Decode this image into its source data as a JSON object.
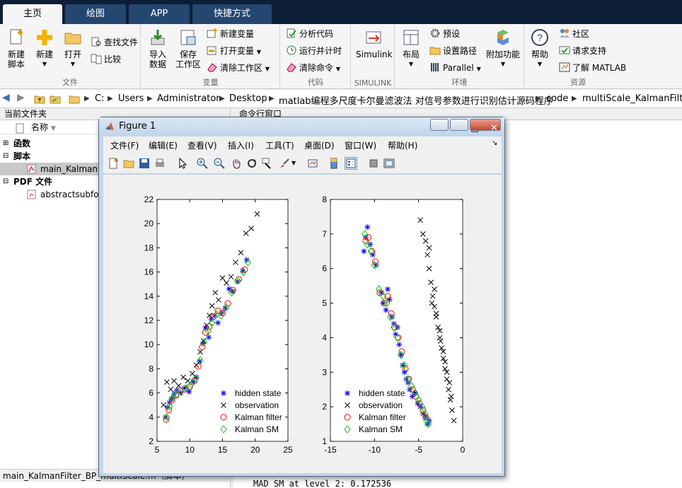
{
  "tabs": [
    {
      "label": "主页",
      "active": true
    },
    {
      "label": "绘图",
      "active": false
    },
    {
      "label": "APP",
      "active": false
    },
    {
      "label": "快捷方式",
      "active": false
    }
  ],
  "ribbon": {
    "file": {
      "label": "文件",
      "new_script": "新建\n脚本",
      "new": "新建",
      "open": "打开",
      "find_files": "查找文件",
      "compare": "比较"
    },
    "variable": {
      "label": "变量",
      "import": "导入\n数据",
      "save_ws": "保存\n工作区",
      "new_var": "新建变量",
      "open_var": "打开变量",
      "clear_ws": "清除工作区"
    },
    "code": {
      "label": "代码",
      "analyze": "分析代码",
      "run_time": "运行并计时",
      "clear_cmd": "清除命令"
    },
    "simulink": {
      "label": "SIMULINK",
      "simulink": "Simulink"
    },
    "env": {
      "label": "环境",
      "layout": "布局",
      "prefs": "预设",
      "set_path": "设置路径",
      "parallel": "Parallel",
      "addons": "附加功能"
    },
    "resources": {
      "label": "资源",
      "help": "帮助",
      "community": "社区",
      "support": "请求支持",
      "learn": "了解 MATLAB"
    }
  },
  "address": {
    "parts": [
      "C:",
      "Users",
      "Administrator",
      "Desktop",
      "matlab编程多尺度卡尔曼滤波法 对信号参数进行识别估计源码程序",
      "code",
      "multiScale_KalmanFilter"
    ]
  },
  "filepanel": {
    "title": "当前文件夹",
    "col_name": "名称",
    "rows": [
      {
        "label": "函数",
        "type": "group"
      },
      {
        "label": "脚本",
        "type": "group"
      },
      {
        "label": "main_KalmanFi",
        "type": "file"
      },
      {
        "label": "PDF 文件",
        "type": "group"
      },
      {
        "label": "abstractsubfo",
        "type": "file"
      }
    ],
    "status": "main_KalmanFilter_BP_multiScale.m（脚本）"
  },
  "cmdpanel": {
    "title": "命令行窗口",
    "line": "MAD SM at level 2: 0.172536"
  },
  "figure": {
    "title": "Figure 1",
    "menu": [
      "文件(F)",
      "编辑(E)",
      "查看(V)",
      "插入(I)",
      "工具(T)",
      "桌面(D)",
      "窗口(W)",
      "帮助(H)"
    ]
  },
  "chart_data": [
    {
      "type": "scatter",
      "xlim": [
        5,
        25
      ],
      "ylim": [
        2,
        22
      ],
      "xticks": [
        "5",
        "10",
        "15",
        "20",
        "25"
      ],
      "yticks": [
        "2",
        "4",
        "6",
        "8",
        "10",
        "12",
        "14",
        "16",
        "18",
        "20",
        "22"
      ],
      "legend": [
        "hidden state",
        "observation",
        "Kalman filter",
        "Kalman SM"
      ],
      "legend_position": "bottom-right",
      "series": [
        {
          "name": "hidden state",
          "marker": "*",
          "color": "#0000ff",
          "x": [
            6.3,
            6.6,
            6.9,
            7.2,
            7.6,
            8.0,
            8.6,
            9.2,
            9.9,
            10.5,
            11.0,
            11.5,
            12.0,
            12.4,
            12.9,
            13.3,
            13.8,
            14.3,
            14.9,
            15.4,
            16.0,
            16.6,
            17.3,
            18.1,
            18.7
          ],
          "y": [
            4.0,
            4.8,
            5.2,
            5.5,
            5.9,
            6.2,
            6.0,
            6.4,
            6.1,
            6.9,
            7.3,
            8.6,
            10.1,
            11.4,
            10.6,
            12.1,
            12.4,
            11.8,
            12.6,
            13.0,
            14.6,
            14.4,
            15.2,
            16.1,
            17.0
          ]
        },
        {
          "name": "observation",
          "marker": "x",
          "color": "#000000",
          "x": [
            6.0,
            6.5,
            7.1,
            7.6,
            8.3,
            9.0,
            9.7,
            10.4,
            11.0,
            11.6,
            12.1,
            12.6,
            13.0,
            13.4,
            13.9,
            14.4,
            15.0,
            15.6,
            16.3,
            17.0,
            17.8,
            18.6,
            19.4,
            20.3
          ],
          "y": [
            5.0,
            6.9,
            6.3,
            7.0,
            6.6,
            7.3,
            7.0,
            7.6,
            8.3,
            9.4,
            10.3,
            11.6,
            12.4,
            13.2,
            14.3,
            13.7,
            15.5,
            15.1,
            15.6,
            16.8,
            17.6,
            19.2,
            19.6,
            20.8
          ]
        },
        {
          "name": "Kalman filter",
          "marker": "o",
          "color": "#ff0000",
          "x": [
            6.4,
            6.8,
            7.3,
            7.9,
            8.5,
            9.3,
            10.0,
            10.7,
            11.3,
            11.9,
            12.4,
            13.0,
            13.6,
            14.3,
            15.0,
            15.8,
            16.6,
            17.5,
            18.4
          ],
          "y": [
            3.8,
            4.6,
            5.4,
            5.8,
            6.2,
            6.3,
            6.5,
            7.0,
            8.2,
            9.8,
            11.0,
            11.5,
            12.3,
            12.8,
            12.6,
            13.4,
            14.5,
            15.4,
            16.2
          ]
        },
        {
          "name": "Kalman SM",
          "marker": "diamond",
          "color": "#00cc00",
          "x": [
            6.5,
            6.9,
            7.4,
            8.0,
            8.7,
            9.4,
            10.2,
            10.9,
            11.6,
            12.2,
            12.8,
            13.4,
            14.1,
            14.8,
            15.6,
            16.4,
            17.3,
            18.2,
            18.9
          ],
          "y": [
            4.0,
            4.9,
            5.6,
            5.9,
            6.1,
            6.4,
            6.7,
            7.2,
            8.7,
            10.2,
            11.1,
            11.8,
            12.5,
            12.4,
            13.1,
            14.3,
            15.3,
            16.0,
            16.8
          ]
        }
      ]
    },
    {
      "type": "scatter",
      "xlim": [
        -15,
        0
      ],
      "ylim": [
        1,
        8
      ],
      "xticks": [
        "-15",
        "-10",
        "-5",
        "0"
      ],
      "yticks": [
        "1",
        "2",
        "3",
        "4",
        "5",
        "6",
        "7",
        "8"
      ],
      "legend": [
        "hidden state",
        "observation",
        "Kalman filter",
        "Kalman SM"
      ],
      "legend_position": "bottom-left",
      "series": [
        {
          "name": "hidden state",
          "marker": "*",
          "color": "#0000ff",
          "x": [
            -11.2,
            -11.0,
            -10.8,
            -10.5,
            -10.2,
            -9.8,
            -9.2,
            -9.0,
            -8.7,
            -8.5,
            -8.3,
            -8.0,
            -7.8,
            -7.6,
            -7.4,
            -7.2,
            -7.0,
            -6.8,
            -6.6,
            -6.4,
            -6.2,
            -6.0,
            -5.7,
            -5.4,
            -5.1,
            -4.8,
            -4.5,
            -4.2,
            -4.0,
            -3.8
          ],
          "y": [
            6.5,
            6.9,
            7.2,
            6.7,
            6.4,
            6.1,
            5.3,
            5.0,
            4.8,
            5.4,
            5.1,
            4.6,
            4.4,
            4.1,
            4.3,
            3.8,
            3.5,
            3.2,
            3.0,
            2.8,
            2.7,
            2.5,
            2.3,
            2.4,
            2.1,
            2.0,
            1.8,
            1.7,
            1.5,
            1.6
          ]
        },
        {
          "name": "observation",
          "marker": "x",
          "color": "#000000",
          "x": [
            -4.8,
            -4.5,
            -4.2,
            -4.0,
            -3.8,
            -3.6,
            -3.4,
            -3.2,
            -3.0,
            -2.8,
            -2.6,
            -2.4,
            -2.2,
            -2.0,
            -1.8,
            -1.6,
            -1.4,
            -1.2,
            -1.0,
            -3.5,
            -3.0,
            -2.5,
            -2.0,
            -1.5,
            -3.8,
            -3.2,
            -2.6,
            -2.2,
            -1.8,
            -1.3
          ],
          "y": [
            7.4,
            7.0,
            6.8,
            6.4,
            6.0,
            5.6,
            5.2,
            4.9,
            4.6,
            4.3,
            4.0,
            3.7,
            3.4,
            3.1,
            2.8,
            2.5,
            2.2,
            1.9,
            1.6,
            5.0,
            4.7,
            3.9,
            3.3,
            2.7,
            6.6,
            5.4,
            4.2,
            3.6,
            3.0,
            2.3
          ]
        },
        {
          "name": "Kalman filter",
          "marker": "o",
          "color": "#ff0000",
          "x": [
            -11.0,
            -10.7,
            -10.3,
            -9.9,
            -9.4,
            -8.9,
            -8.5,
            -8.1,
            -7.7,
            -7.3,
            -6.9,
            -6.5,
            -6.1,
            -5.7,
            -5.3,
            -4.9,
            -4.5,
            -4.2
          ],
          "y": [
            6.8,
            6.9,
            6.5,
            6.2,
            5.3,
            5.0,
            5.2,
            4.7,
            4.3,
            4.0,
            3.6,
            3.1,
            2.8,
            2.5,
            2.3,
            2.1,
            1.9,
            1.7
          ]
        },
        {
          "name": "Kalman SM",
          "marker": "diamond",
          "color": "#00cc00",
          "x": [
            -11.1,
            -10.8,
            -10.4,
            -10.0,
            -9.5,
            -9.0,
            -8.6,
            -8.2,
            -7.8,
            -7.4,
            -7.0,
            -6.6,
            -6.2,
            -5.8,
            -5.4,
            -5.0,
            -4.6,
            -4.3,
            -4.1,
            -3.9
          ],
          "y": [
            7.0,
            6.7,
            6.5,
            6.1,
            5.4,
            5.2,
            5.0,
            4.6,
            4.3,
            4.0,
            3.5,
            3.2,
            2.8,
            2.6,
            2.4,
            2.2,
            2.0,
            1.8,
            1.6,
            1.5
          ]
        }
      ]
    }
  ]
}
